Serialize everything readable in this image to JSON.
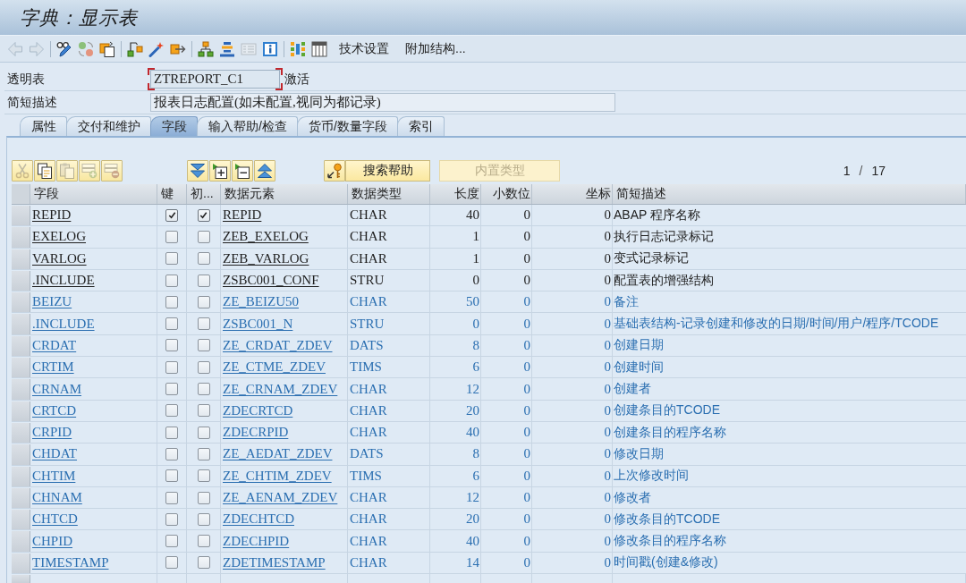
{
  "window": {
    "title": "字典：显示表"
  },
  "toolbar": {
    "groups": [
      [
        {
          "kind": "back",
          "disabled": true
        },
        {
          "kind": "forward",
          "disabled": true
        }
      ],
      [
        {
          "kind": "glasses_pencil",
          "disabled": false
        },
        {
          "kind": "circles",
          "disabled": false
        },
        {
          "kind": "documents",
          "disabled": false
        }
      ],
      [
        {
          "kind": "squares_arrow",
          "disabled": false
        },
        {
          "kind": "wand",
          "disabled": false
        },
        {
          "kind": "box_arrow",
          "disabled": false
        }
      ],
      [
        {
          "kind": "hierarchy",
          "disabled": false
        },
        {
          "kind": "stacked_bars",
          "disabled": false
        },
        {
          "kind": "list",
          "disabled": true
        },
        {
          "kind": "info",
          "disabled": false
        }
      ],
      [
        {
          "kind": "tiles",
          "disabled": false
        },
        {
          "kind": "table",
          "disabled": false
        }
      ],
      [
        {
          "kind": "text",
          "label": "技术设置",
          "disabled": false
        },
        {
          "kind": "text",
          "label": "附加结构...",
          "disabled": false
        }
      ]
    ]
  },
  "header": {
    "fields": [
      {
        "label": "透明表",
        "value": "ZTREPORT_C1",
        "focused": true,
        "status": "激活"
      },
      {
        "label": "简短描述",
        "value": "报表日志配置(如未配置,视同为都记录)",
        "focused": false
      }
    ]
  },
  "tabs": [
    {
      "label": "属性",
      "selected": false
    },
    {
      "label": "交付和维护",
      "selected": false
    },
    {
      "label": "字段",
      "selected": true
    },
    {
      "label": "输入帮助/检查",
      "selected": false
    },
    {
      "label": "货币/数量字段",
      "selected": false
    },
    {
      "label": "索引",
      "selected": false
    }
  ],
  "table_toolbar": {
    "groups": [
      [
        {
          "kind": "cut",
          "disabled": true
        },
        {
          "kind": "copy",
          "disabled": false
        },
        {
          "kind": "paste",
          "disabled": true
        },
        {
          "kind": "insert_row",
          "disabled": true
        },
        {
          "kind": "delete_row",
          "disabled": true
        }
      ],
      [
        {
          "kind": "chevrons_down",
          "disabled": false
        },
        {
          "kind": "expand",
          "disabled": false
        },
        {
          "kind": "collapse",
          "disabled": false
        },
        {
          "kind": "chevrons_up",
          "disabled": false
        }
      ],
      [
        {
          "kind": "key",
          "disabled": false
        },
        {
          "kind": "text",
          "label": "搜索帮助",
          "disabled": false
        }
      ],
      [
        {
          "kind": "text",
          "label": "内置类型",
          "disabled": true
        }
      ]
    ]
  },
  "pager": {
    "current": "1",
    "separator": "/",
    "total": "17"
  },
  "table": {
    "columns": [
      "字段",
      "键",
      "初...",
      "数据元素",
      "数据类型",
      "长度",
      "小数位",
      "坐标",
      "简短描述"
    ],
    "rows": [
      {
        "field": "REPID",
        "key": true,
        "initial": true,
        "data_element": "REPID",
        "data_type": "CHAR",
        "length": "40",
        "decimals": "0",
        "coordinate": "0",
        "description": "ABAP 程序名称",
        "included": false
      },
      {
        "field": "EXELOG",
        "key": false,
        "initial": false,
        "data_element": "ZEB_EXELOG",
        "data_type": "CHAR",
        "length": "1",
        "decimals": "0",
        "coordinate": "0",
        "description": "执行日志记录标记",
        "included": false
      },
      {
        "field": "VARLOG",
        "key": false,
        "initial": false,
        "data_element": "ZEB_VARLOG",
        "data_type": "CHAR",
        "length": "1",
        "decimals": "0",
        "coordinate": "0",
        "description": "变式记录标记",
        "included": false
      },
      {
        "field": ".INCLUDE",
        "key": false,
        "initial": false,
        "data_element": "ZSBC001_CONF",
        "data_type": "STRU",
        "length": "0",
        "decimals": "0",
        "coordinate": "0",
        "description": "配置表的增强结构",
        "included": false
      },
      {
        "field": "BEIZU",
        "key": false,
        "initial": false,
        "data_element": "ZE_BEIZU50",
        "data_type": "CHAR",
        "length": "50",
        "decimals": "0",
        "coordinate": "0",
        "description": "备注",
        "included": true
      },
      {
        "field": ".INCLUDE",
        "key": false,
        "initial": false,
        "data_element": "ZSBC001_N",
        "data_type": "STRU",
        "length": "0",
        "decimals": "0",
        "coordinate": "0",
        "description": "基础表结构-记录创建和修改的日期/时间/用户/程序/TCODE",
        "included": true
      },
      {
        "field": "CRDAT",
        "key": false,
        "initial": false,
        "data_element": "ZE_CRDAT_ZDEV",
        "data_type": "DATS",
        "length": "8",
        "decimals": "0",
        "coordinate": "0",
        "description": "创建日期",
        "included": true
      },
      {
        "field": "CRTIM",
        "key": false,
        "initial": false,
        "data_element": "ZE_CTME_ZDEV",
        "data_type": "TIMS",
        "length": "6",
        "decimals": "0",
        "coordinate": "0",
        "description": "创建时间",
        "included": true
      },
      {
        "field": "CRNAM",
        "key": false,
        "initial": false,
        "data_element": "ZE_CRNAM_ZDEV",
        "data_type": "CHAR",
        "length": "12",
        "decimals": "0",
        "coordinate": "0",
        "description": "创建者",
        "included": true
      },
      {
        "field": "CRTCD",
        "key": false,
        "initial": false,
        "data_element": "ZDECRTCD",
        "data_type": "CHAR",
        "length": "20",
        "decimals": "0",
        "coordinate": "0",
        "description": "创建条目的TCODE",
        "included": true
      },
      {
        "field": "CRPID",
        "key": false,
        "initial": false,
        "data_element": "ZDECRPID",
        "data_type": "CHAR",
        "length": "40",
        "decimals": "0",
        "coordinate": "0",
        "description": "创建条目的程序名称",
        "included": true
      },
      {
        "field": "CHDAT",
        "key": false,
        "initial": false,
        "data_element": "ZE_AEDAT_ZDEV",
        "data_type": "DATS",
        "length": "8",
        "decimals": "0",
        "coordinate": "0",
        "description": "修改日期",
        "included": true
      },
      {
        "field": "CHTIM",
        "key": false,
        "initial": false,
        "data_element": "ZE_CHTIM_ZDEV",
        "data_type": "TIMS",
        "length": "6",
        "decimals": "0",
        "coordinate": "0",
        "description": "上次修改时间",
        "included": true
      },
      {
        "field": "CHNAM",
        "key": false,
        "initial": false,
        "data_element": "ZE_AENAM_ZDEV",
        "data_type": "CHAR",
        "length": "12",
        "decimals": "0",
        "coordinate": "0",
        "description": "修改者",
        "included": true
      },
      {
        "field": "CHTCD",
        "key": false,
        "initial": false,
        "data_element": "ZDECHTCD",
        "data_type": "CHAR",
        "length": "20",
        "decimals": "0",
        "coordinate": "0",
        "description": "修改条目的TCODE",
        "included": true
      },
      {
        "field": "CHPID",
        "key": false,
        "initial": false,
        "data_element": "ZDECHPID",
        "data_type": "CHAR",
        "length": "40",
        "decimals": "0",
        "coordinate": "0",
        "description": "修改条目的程序名称",
        "included": true
      },
      {
        "field": "TIMESTAMP",
        "key": false,
        "initial": false,
        "data_element": "ZDETIMESTAMP",
        "data_type": "CHAR",
        "length": "14",
        "decimals": "0",
        "coordinate": "0",
        "description": "时间戳(创建&修改)",
        "included": true
      }
    ]
  }
}
